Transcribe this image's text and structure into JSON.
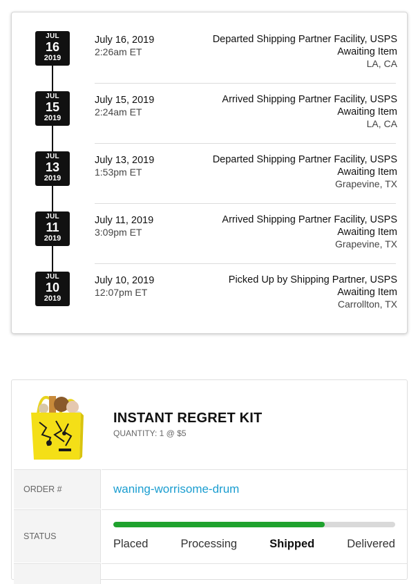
{
  "tracking": {
    "events": [
      {
        "month": "JUL",
        "day": "16",
        "year": "2019",
        "date": "July 16, 2019",
        "time": "2:26am ET",
        "description": "Departed Shipping Partner Facility, USPS Awaiting Item",
        "location": "LA, CA"
      },
      {
        "month": "JUL",
        "day": "15",
        "year": "2019",
        "date": "July 15, 2019",
        "time": "2:24am ET",
        "description": "Arrived Shipping Partner Facility, USPS Awaiting Item",
        "location": "LA, CA"
      },
      {
        "month": "JUL",
        "day": "13",
        "year": "2019",
        "date": "July 13, 2019",
        "time": "1:53pm ET",
        "description": "Departed Shipping Partner Facility, USPS Awaiting Item",
        "location": "Grapevine, TX"
      },
      {
        "month": "JUL",
        "day": "11",
        "year": "2019",
        "date": "July 11, 2019",
        "time": "3:09pm ET",
        "description": "Arrived Shipping Partner Facility, USPS Awaiting Item",
        "location": "Grapevine, TX"
      },
      {
        "month": "JUL",
        "day": "10",
        "year": "2019",
        "date": "July 10, 2019",
        "time": "12:07pm ET",
        "description": "Picked Up by Shipping Partner, USPS Awaiting Item",
        "location": "Carrollton, TX"
      }
    ]
  },
  "order": {
    "product_name": "INSTANT REGRET KIT",
    "quantity_text": "QUANTITY: 1 @ $5",
    "order_label": "ORDER #",
    "order_id": "waning-worrisome-drum",
    "status_label": "STATUS",
    "progress_fraction": 0.75,
    "steps": [
      "Placed",
      "Processing",
      "Shipped",
      "Delivered"
    ],
    "active_step": "Shipped",
    "colors": {
      "progress": "#1fa22e",
      "link": "#1a9dd0"
    }
  }
}
